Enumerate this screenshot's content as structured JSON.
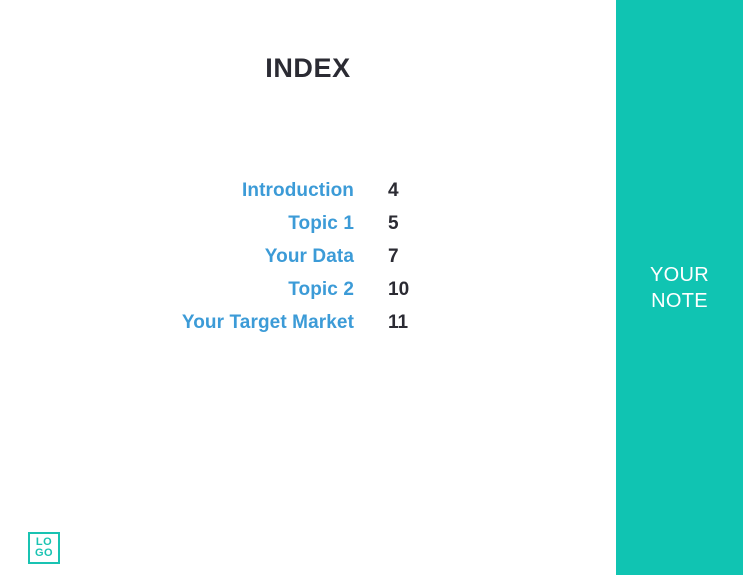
{
  "slide": {
    "title": "INDEX",
    "background_color": "#ffffff"
  },
  "index": {
    "entries": [
      {
        "label": "Introduction",
        "page": "4"
      },
      {
        "label": "Topic 1",
        "page": "5"
      },
      {
        "label": "Your Data",
        "page": "7"
      },
      {
        "label": "Topic 2",
        "page": "10"
      },
      {
        "label": "Your Target Market",
        "page": "11"
      }
    ],
    "label_color": "#3c9bd7",
    "page_number_color": "#2b2b33"
  },
  "note_panel": {
    "line1": "YOUR",
    "line2": "NOTE",
    "background_color": "#10c4b2",
    "text_color": "#ffffff"
  },
  "logo": {
    "line1": "LO",
    "line2": "GO",
    "color": "#19c3b2"
  }
}
